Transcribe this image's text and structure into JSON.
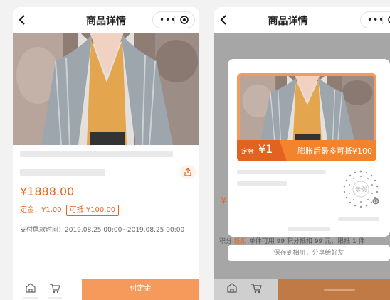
{
  "left": {
    "nav_title": "商品详情",
    "capsule_more": "•••",
    "price": "¥1888.00",
    "deposit_label": "定金：¥1.00",
    "deduct_tag": "可抵 ¥100.00",
    "tail_time": "支付尾款时间：2019.08.25 00:00~2019.08.25 00:00",
    "pay_button": "付定金"
  },
  "right": {
    "nav_title": "商品详情",
    "capsule_more": "•••",
    "behind_price": "¥",
    "popup": {
      "banner_deposit_label": "定金",
      "banner_deposit_value": "¥1",
      "banner_expand": "膨胀后最多可抵¥100",
      "qr_label": "示例"
    },
    "behind_text_prefix": "积分",
    "behind_text_tag": "抵扣",
    "behind_text_rest": "单件可用 99 积分抵扣 99 元，限抵 1 件",
    "save_bar": "保存到相册，分享给好友"
  },
  "colors": {
    "accent": "#e8641b",
    "pay_button": "#f59a5a",
    "banner": "#f3832c"
  }
}
